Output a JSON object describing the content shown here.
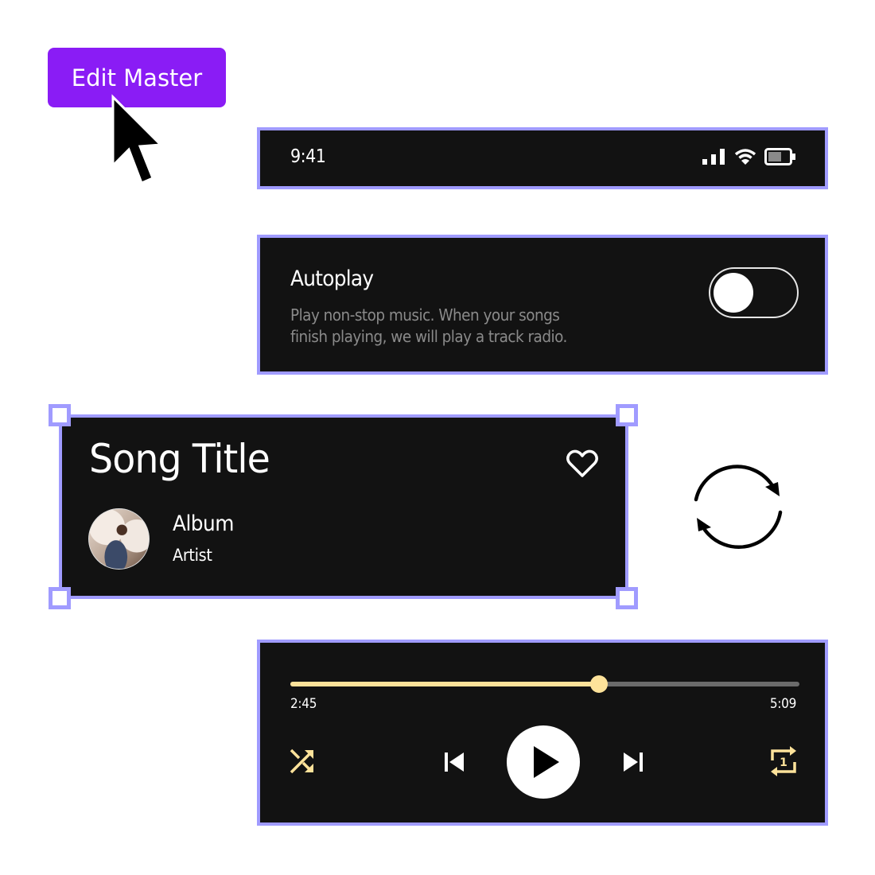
{
  "edit_button": {
    "label": "Edit Master"
  },
  "status_bar": {
    "time": "9:41",
    "icons": [
      "signal-icon",
      "wifi-icon",
      "battery-icon"
    ],
    "battery_level": 0.6
  },
  "autoplay": {
    "title": "Autoplay",
    "description": "Play non-stop music. When your songs finish playing, we will play a track radio.",
    "enabled": false
  },
  "song_card": {
    "title": "Song Title",
    "album": "Album",
    "artist": "Artist",
    "liked": false
  },
  "player": {
    "current_time": "2:45",
    "total_time": "5:09",
    "progress": 0.607,
    "controls": [
      "shuffle-icon",
      "previous-icon",
      "play-icon",
      "next-icon",
      "repeat-one-icon"
    ],
    "repeat_badge": "1"
  },
  "colors": {
    "accent_purple": "#8a1cf5",
    "frame_border": "#a09bff",
    "card_bg": "#121212",
    "player_accent": "#fde29a",
    "track_rest": "#6b6b6b",
    "muted_text": "#8a8a8a"
  }
}
